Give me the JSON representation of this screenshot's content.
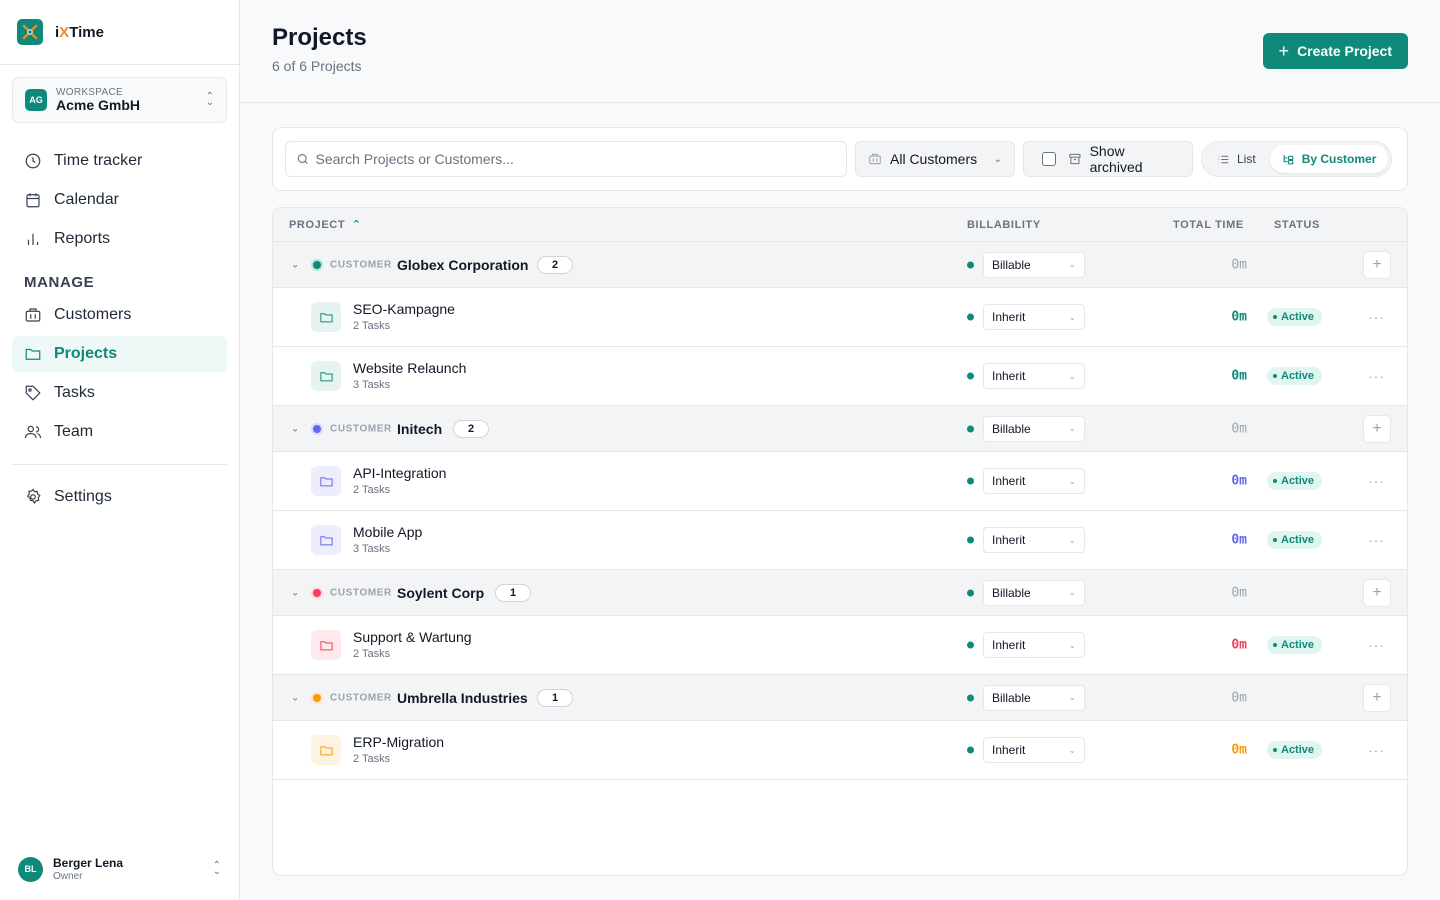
{
  "app": {
    "name_prefix": "i",
    "name_x": "X",
    "name_suffix": "Time"
  },
  "workspace": {
    "label": "WORKSPACE",
    "name": "Acme GmbH",
    "initials": "AG"
  },
  "nav": {
    "primary": [
      {
        "label": "Time tracker",
        "icon": "clock-icon"
      },
      {
        "label": "Calendar",
        "icon": "calendar-icon"
      },
      {
        "label": "Reports",
        "icon": "bar-chart-icon"
      }
    ],
    "manage_heading": "MANAGE",
    "manage": [
      {
        "label": "Customers",
        "icon": "building-icon"
      },
      {
        "label": "Projects",
        "icon": "folder-icon",
        "active": true
      },
      {
        "label": "Tasks",
        "icon": "tag-icon"
      },
      {
        "label": "Team",
        "icon": "users-icon"
      }
    ],
    "settings": {
      "label": "Settings",
      "icon": "gear-icon"
    }
  },
  "user": {
    "name": "Berger Lena",
    "role": "Owner",
    "initials": "BL"
  },
  "header": {
    "title": "Projects",
    "subtitle": "6 of 6 Projects",
    "create_label": "Create Project"
  },
  "toolbar": {
    "search_placeholder": "Search Projects or Customers...",
    "customer_filter": "All Customers",
    "show_archived": "Show archived",
    "view_list": "List",
    "view_by_customer": "By Customer"
  },
  "table": {
    "columns": {
      "project": "PROJECT",
      "billability": "BILLABILITY",
      "total_time": "TOTAL TIME",
      "status": "STATUS"
    },
    "customer_label": "CUSTOMER",
    "groups": [
      {
        "name": "Globex Corporation",
        "count": "2",
        "color": "#0f8a7a",
        "billability": "Billable",
        "time": "0m",
        "projects": [
          {
            "name": "SEO-Kampagne",
            "tasks": "2 Tasks",
            "billability": "Inherit",
            "time": "0m",
            "status": "Active"
          },
          {
            "name": "Website Relaunch",
            "tasks": "3 Tasks",
            "billability": "Inherit",
            "time": "0m",
            "status": "Active"
          }
        ]
      },
      {
        "name": "Initech",
        "count": "2",
        "color": "#6366f1",
        "billability": "Billable",
        "time": "0m",
        "projects": [
          {
            "name": "API-Integration",
            "tasks": "2 Tasks",
            "billability": "Inherit",
            "time": "0m",
            "status": "Active"
          },
          {
            "name": "Mobile App",
            "tasks": "3 Tasks",
            "billability": "Inherit",
            "time": "0m",
            "status": "Active"
          }
        ]
      },
      {
        "name": "Soylent Corp",
        "count": "1",
        "color": "#f43f5e",
        "billability": "Billable",
        "time": "0m",
        "projects": [
          {
            "name": "Support & Wartung",
            "tasks": "2 Tasks",
            "billability": "Inherit",
            "time": "0m",
            "status": "Active"
          }
        ]
      },
      {
        "name": "Umbrella Industries",
        "count": "1",
        "color": "#f59e0b",
        "billability": "Billable",
        "time": "0m",
        "projects": [
          {
            "name": "ERP-Migration",
            "tasks": "2 Tasks",
            "billability": "Inherit",
            "time": "0m",
            "status": "Active"
          }
        ]
      }
    ]
  },
  "colors": {
    "accent": "#0f8a7a",
    "status_bg": "#e0f5f0"
  }
}
